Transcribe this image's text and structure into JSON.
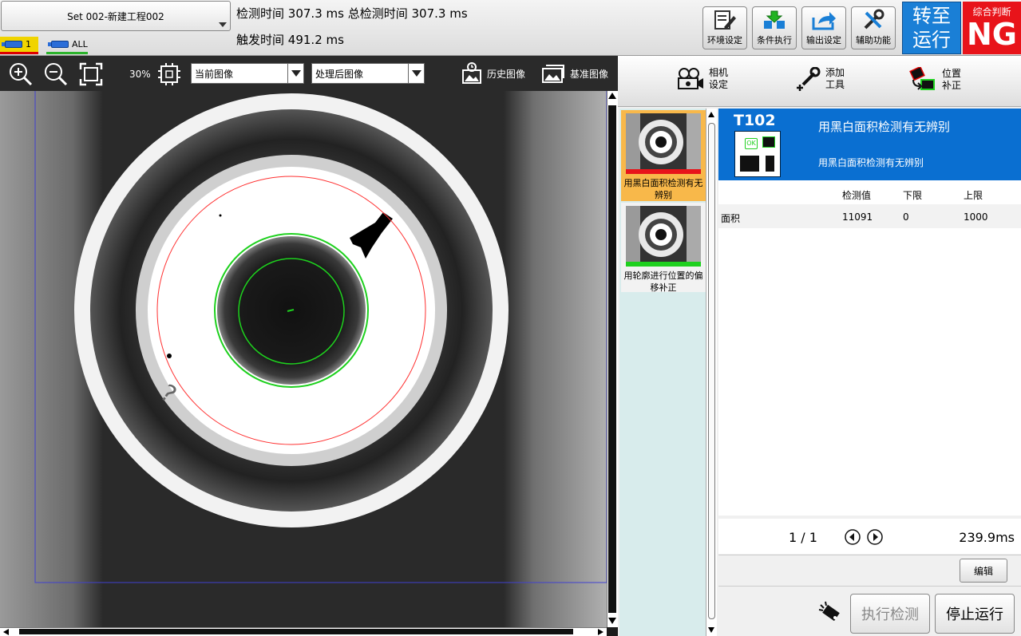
{
  "project": {
    "name": "Set 002-新建工程002"
  },
  "camera_tabs": [
    {
      "label": "1"
    },
    {
      "label": "ALL"
    }
  ],
  "timing": {
    "detect_label": "检测时间",
    "detect_value": "307.3 ms",
    "total_label": "总检测时间",
    "total_value": "307.3 ms",
    "trigger_label": "触发时间",
    "trigger_value": "491.2 ms"
  },
  "toolbar": {
    "env": "环境设定",
    "cond": "条件执行",
    "output": "输出设定",
    "aux": "辅助功能",
    "switch_line1": "转至",
    "switch_line2": "运行",
    "judge_label": "综合判断",
    "judge_value": "NG"
  },
  "image_toolbar": {
    "zoom": "30%",
    "current_image": "当前图像",
    "processed_image": "处理后图像",
    "history": "历史图像",
    "reference": "基准图像"
  },
  "right_toolbar": {
    "camera_l1": "相机",
    "camera_l2": "设定",
    "addtool_l1": "添加",
    "addtool_l2": "工具",
    "poscorr_l1": "位置",
    "poscorr_l2": "补正"
  },
  "tools": [
    {
      "label": "用黑白面积检测有无辨别",
      "status": "NG",
      "status_color": "#e8141a"
    },
    {
      "label": "用轮廓进行位置的偏移补正",
      "status": "OK",
      "status_color": "#1ed01e"
    }
  ],
  "detail": {
    "id": "T102",
    "title": "用黑白面积检测有无辨别",
    "subtitle": "用黑白面积检测有无辨别",
    "columns": [
      "检测值",
      "下限",
      "上限"
    ],
    "rows": [
      {
        "name": "面积",
        "value": "11091",
        "low": "0",
        "high": "1000"
      }
    ]
  },
  "pager": {
    "page": "1 / 1",
    "time": "239.9ms"
  },
  "buttons": {
    "edit": "编辑",
    "execute": "执行检测",
    "stop": "停止运行"
  },
  "colors": {
    "accent": "#0a6fd1",
    "ng": "#e8141a",
    "ok": "#1ed01e",
    "selected_tool": "#f8b84a"
  }
}
